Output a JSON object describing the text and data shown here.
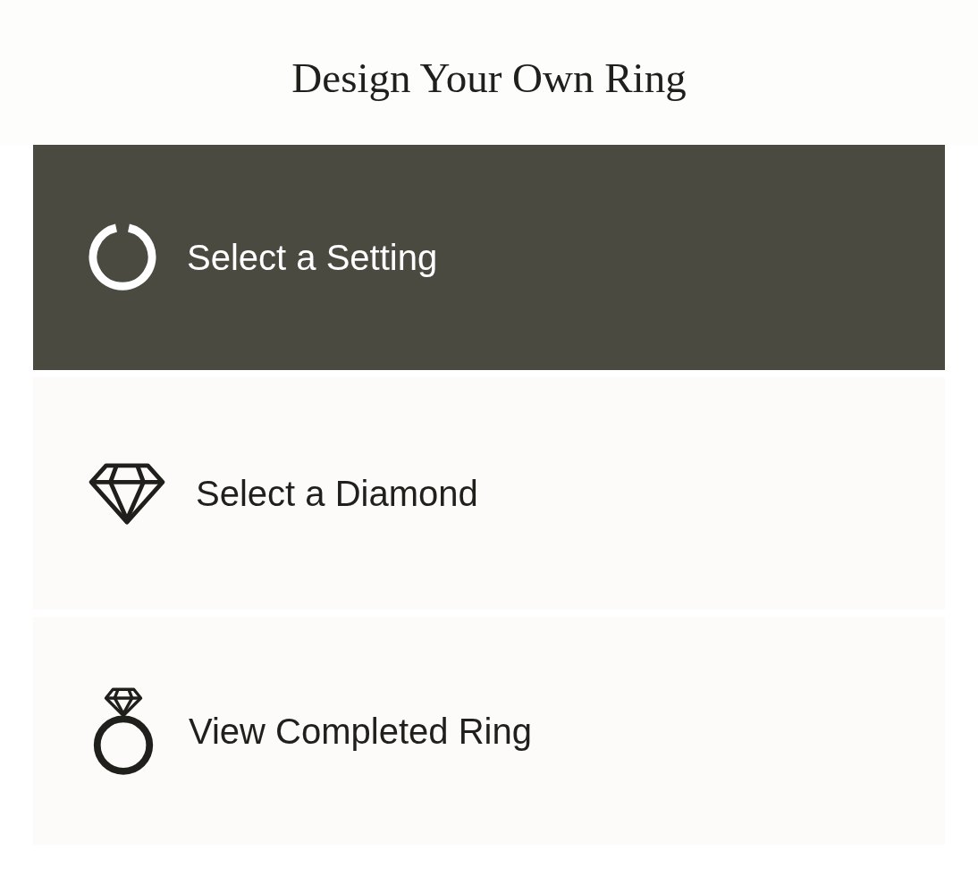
{
  "title": "Design Your Own Ring",
  "steps": [
    {
      "kind": "setting",
      "label": "Select a Setting",
      "selected": true
    },
    {
      "kind": "diamond",
      "label": "Select a Diamond",
      "selected": false
    },
    {
      "kind": "ring",
      "label": "View Completed Ring",
      "selected": false
    }
  ]
}
